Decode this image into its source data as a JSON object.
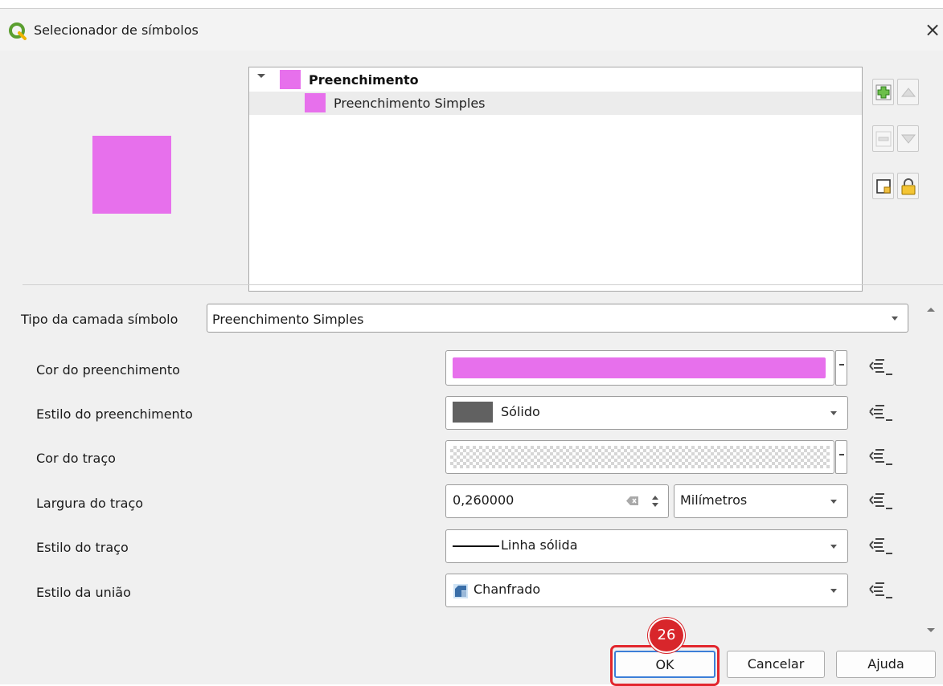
{
  "top_caption_fragment": "",
  "window": {
    "title": "Selecionador de símbolos",
    "close_glyph": "×",
    "icon": "qgis-logo-icon"
  },
  "preview": {
    "fill_color": "#e770ec"
  },
  "symbol_tree": {
    "items": [
      {
        "label": "Preenchimento",
        "level": 0,
        "expanded": true,
        "swatch_color": "#e770ec",
        "bold": true
      },
      {
        "label": "Preenchimento Simples",
        "level": 1,
        "selected": true,
        "swatch_color": "#e770ec",
        "bold": false
      }
    ]
  },
  "tools": {
    "add": "add-layer-icon",
    "move_up": "move-up-icon",
    "remove": "remove-layer-icon",
    "move_down": "move-down-icon",
    "duplicate": "duplicate-layer-icon",
    "lock": "lock-icon"
  },
  "layer_type": {
    "label": "Tipo da camada símbolo",
    "value": "Preenchimento Simples"
  },
  "properties": {
    "fill_color": {
      "label": "Cor do preenchimento",
      "color": "#e770ec"
    },
    "fill_style": {
      "label": "Estilo do preenchimento",
      "value": "Sólido",
      "swatch_color": "#616161"
    },
    "stroke_color": {
      "label": "Cor do traço",
      "color": "transparent"
    },
    "stroke_width": {
      "label": "Largura do traço",
      "value": "0,260000",
      "unit": "Milímetros"
    },
    "stroke_style": {
      "label": "Estilo do traço",
      "value": "Linha sólida"
    },
    "join_style": {
      "label": "Estilo da união",
      "value": "Chanfrado"
    }
  },
  "annotation": {
    "step_number": "26",
    "highlight_color": "#e2262d"
  },
  "buttons": {
    "ok": "OK",
    "cancel": "Cancelar",
    "help": "Ajuda"
  }
}
